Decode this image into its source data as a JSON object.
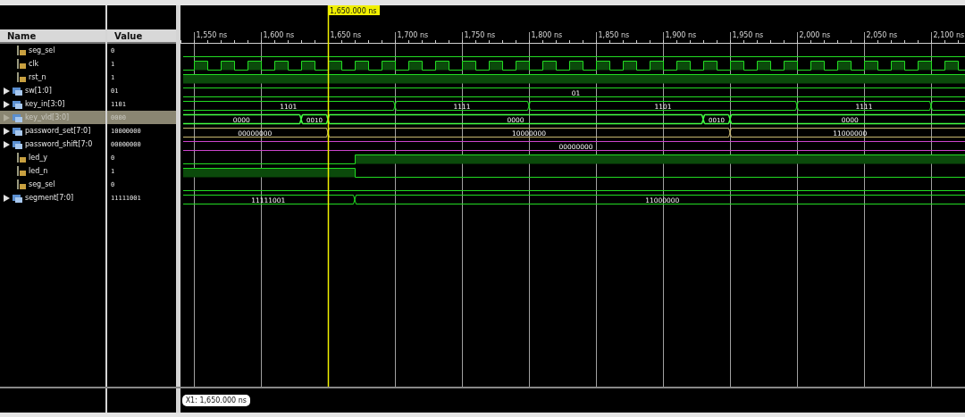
{
  "cursor": {
    "label": "1,650.000 ns"
  },
  "columns": {
    "name": "Name",
    "value": "Value"
  },
  "axis": {
    "ticks": [
      "1,550 ns",
      "1,600 ns",
      "1,650 ns",
      "1,700 ns",
      "1,750 ns",
      "1,800 ns",
      "1,850 ns",
      "1,900 ns",
      "1,950 ns",
      "2,000 ns",
      "2,050 ns",
      "2,100 ns"
    ]
  },
  "signals": [
    {
      "name": "seg_sel",
      "value": "0",
      "kind": "bit",
      "selected": false
    },
    {
      "name": "clk",
      "value": "1",
      "kind": "clock",
      "selected": false
    },
    {
      "name": "rst_n",
      "value": "1",
      "kind": "bit",
      "selected": false
    },
    {
      "name": "sw[1:0]",
      "value": "01",
      "kind": "bus",
      "selected": false,
      "color": "#22dd22",
      "segments": [
        "01"
      ]
    },
    {
      "name": "key_in[3:0]",
      "value": "1101",
      "kind": "bus",
      "selected": false,
      "color": "#22dd22",
      "segments": [
        "1101",
        "1111",
        "1101",
        "1111"
      ]
    },
    {
      "name": "key_vld[3:0]",
      "value": "0000",
      "kind": "bus",
      "selected": true,
      "color": "#44ff44",
      "segments": [
        "0000",
        "0010",
        "0000",
        "0010",
        "0000"
      ]
    },
    {
      "name": "password_set[7:0]",
      "value": "10000000",
      "kind": "bus",
      "selected": false,
      "color": "#c8b870",
      "segments": [
        "00000000",
        "10000000",
        "11000000"
      ]
    },
    {
      "name": "password_shift[7:0",
      "value": "00000000",
      "kind": "bus",
      "selected": false,
      "color": "#cc44cc",
      "segments": [
        "00000000"
      ]
    },
    {
      "name": "led_y",
      "value": "0",
      "kind": "bit",
      "selected": false
    },
    {
      "name": "led_n",
      "value": "1",
      "kind": "bit",
      "selected": false
    },
    {
      "name": "seg_sel",
      "value": "0",
      "kind": "bit",
      "selected": false
    },
    {
      "name": "segment[7:0]",
      "value": "11111001",
      "kind": "bus",
      "selected": false,
      "color": "#22dd22",
      "segments": [
        "11111001",
        "11000000"
      ]
    }
  ],
  "marker": {
    "label": "X1: 1,650.000 ns"
  }
}
